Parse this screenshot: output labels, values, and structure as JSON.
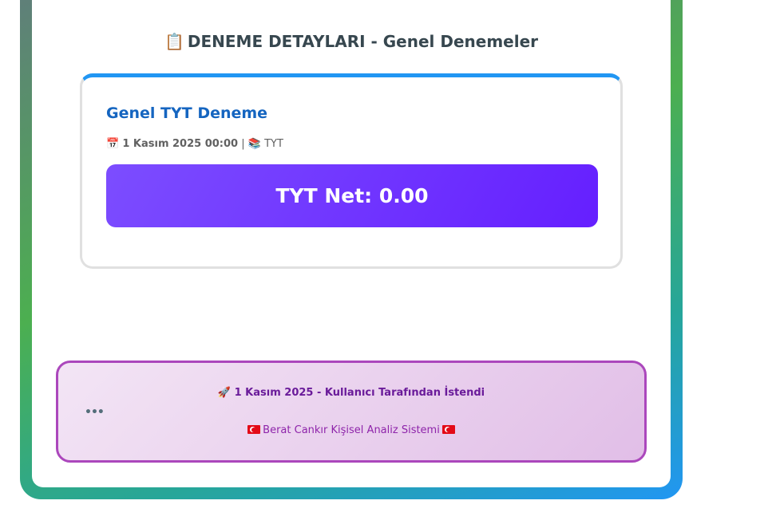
{
  "section": {
    "icon": "📋",
    "icon_name": "clipboard-icon",
    "title": "DENEME DETAYLARI - Genel Denemeler"
  },
  "exam": {
    "title": "Genel TYT Deneme",
    "date_icon": "📅",
    "date": "1 Kasım 2025 00:00",
    "separator": "|",
    "type_icon": "📚",
    "type": "TYT",
    "net_text": "TYT Net: 0.00"
  },
  "footer": {
    "rocket_icon": "🚀",
    "request_text": "1 Kasım 2025 - Kullanıcı Tarafından İstendi",
    "dots": "•••",
    "system_text": "Berat Cankır Kişisel Analiz Sistemi",
    "flag_icon": "turkish-flag-icon"
  },
  "colors": {
    "accent_blue": "#2196f3",
    "title_blue": "#1565c0",
    "net_purple": "#651fff",
    "footer_border": "#ab47bc",
    "footer_text": "#6a1b9a"
  }
}
